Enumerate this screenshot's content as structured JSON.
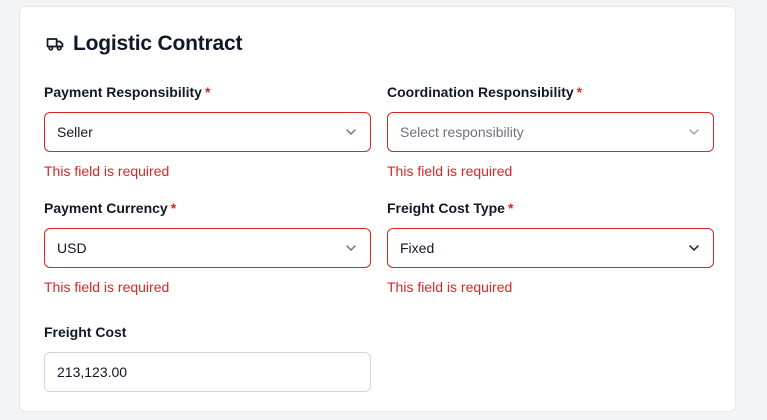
{
  "header": {
    "title": "Logistic Contract",
    "icon": "truck-icon"
  },
  "required_marker": "*",
  "fields": {
    "payment_responsibility": {
      "label": "Payment Responsibility",
      "value": "Seller",
      "error": "This field is required"
    },
    "coordination_responsibility": {
      "label": "Coordination Responsibility",
      "placeholder": "Select responsibility",
      "error": "This field is required"
    },
    "payment_currency": {
      "label": "Payment Currency",
      "value": "USD",
      "error": "This field is required"
    },
    "freight_cost_type": {
      "label": "Freight Cost Type",
      "value": "Fixed",
      "error": "This field is required"
    },
    "freight_cost": {
      "label": "Freight Cost",
      "value": "213,123.00"
    }
  },
  "colors": {
    "error": "#dc2626",
    "border": "#d1d5db",
    "text": "#111827",
    "placeholder": "#6b7280"
  }
}
